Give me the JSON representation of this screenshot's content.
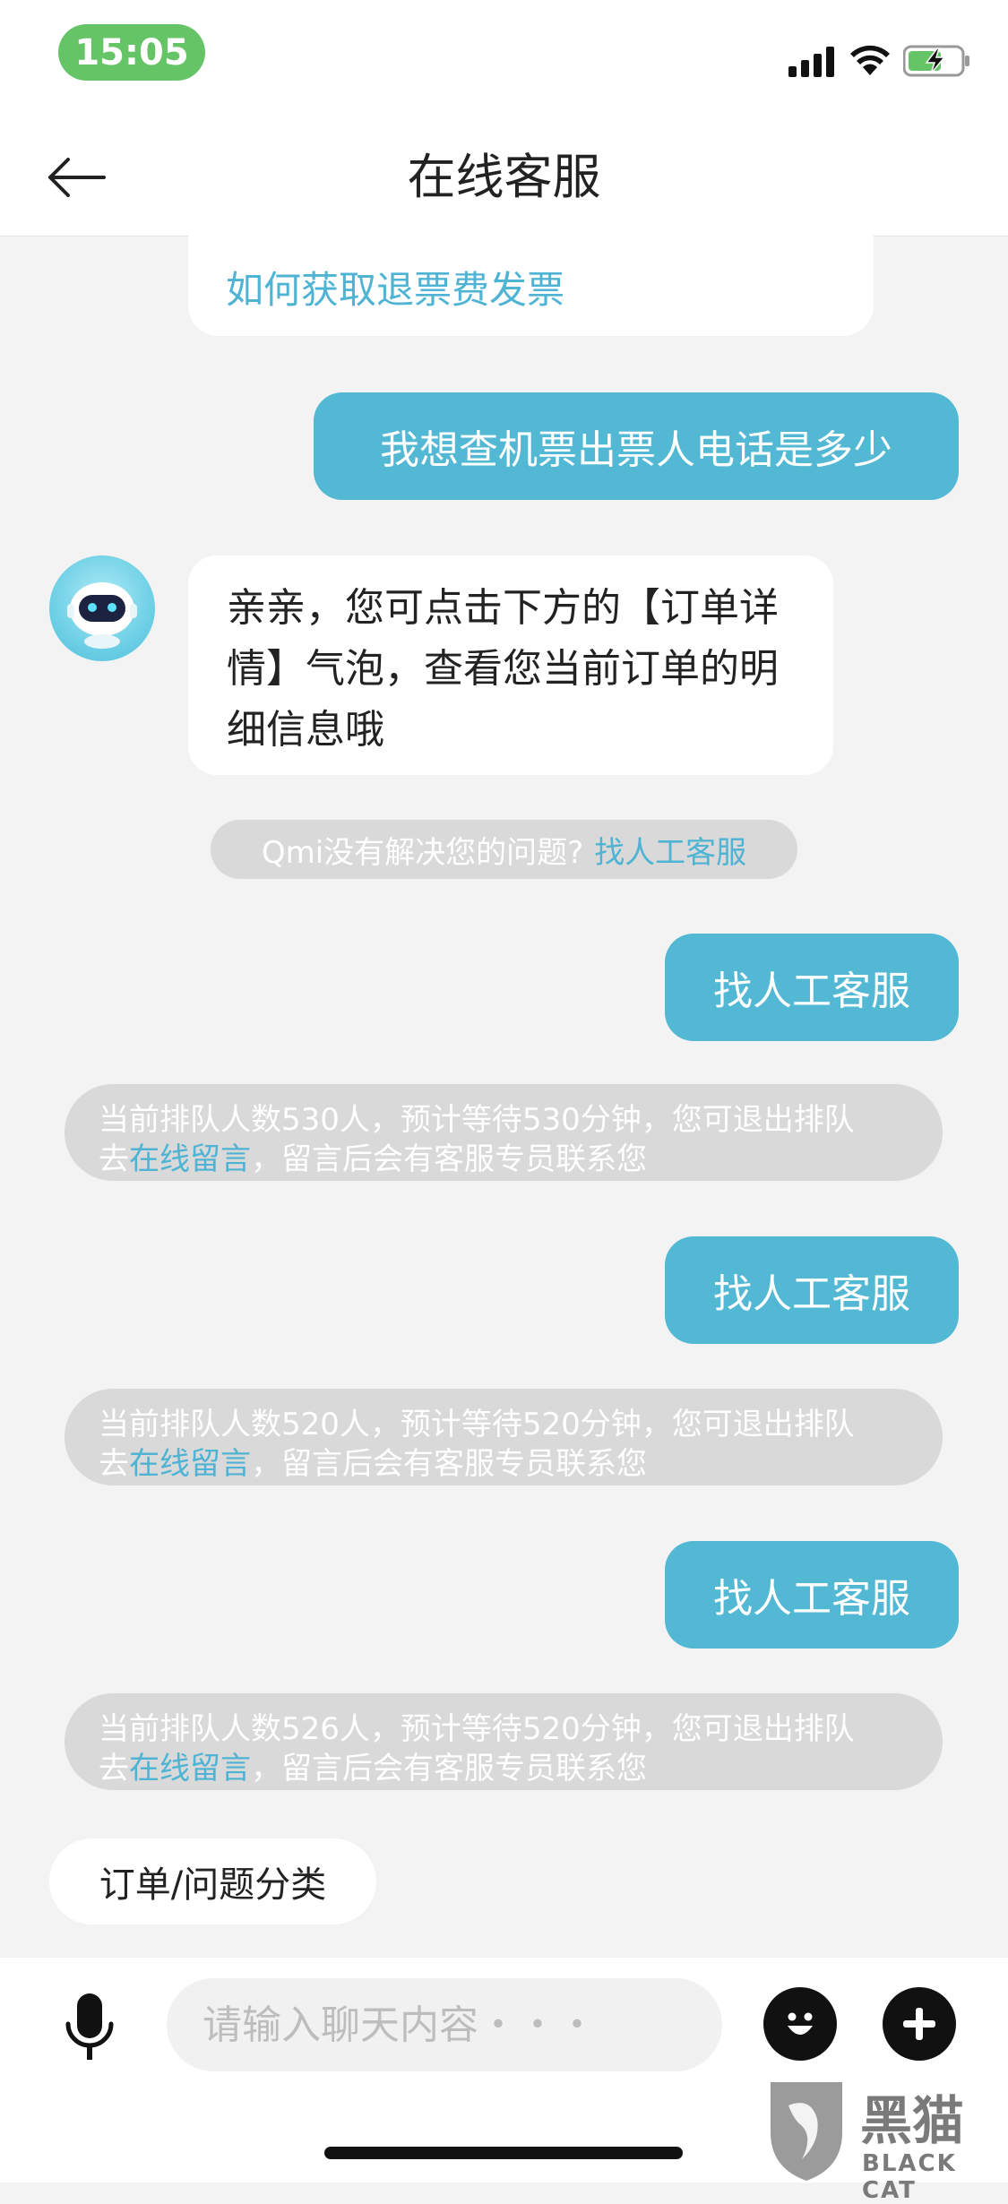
{
  "status_bar": {
    "time": "15:05",
    "icons": [
      "signal-icon",
      "wifi-icon",
      "battery-charging-icon"
    ],
    "time_pill_color": "#65c466"
  },
  "nav": {
    "title": "在线客服",
    "back_icon": "back-arrow-icon"
  },
  "messages": {
    "faq_link": "如何获取退票费发票",
    "user_1": "我想查机票出票人电话是多少",
    "bot_1": "亲亲，您可点击下方的【订单详情】气泡，查看您当前订单的明细信息哦",
    "hint_text": "Qmi没有解决您的问题?",
    "hint_link": "找人工客服",
    "user_2": "找人工客服",
    "queue_1": {
      "line1": "当前排队人数530人，预计等待530分钟，您可退出排队",
      "prefix": "去",
      "link": "在线留言",
      "suffix": "，留言后会有客服专员联系您"
    },
    "user_3": "找人工客服",
    "queue_2": {
      "line1": "当前排队人数520人，预计等待520分钟，您可退出排队",
      "prefix": "去",
      "link": "在线留言",
      "suffix": "，留言后会有客服专员联系您"
    },
    "user_4": "找人工客服",
    "queue_3": {
      "line1": "当前排队人数526人，预计等待520分钟，您可退出排队",
      "prefix": "去",
      "link": "在线留言",
      "suffix": "，留言后会有客服专员联系您"
    }
  },
  "quick_chip": "订单/问题分类",
  "input": {
    "placeholder": "请输入聊天内容・・・",
    "mic_icon": "microphone-icon",
    "emoji_icon": "emoji-icon",
    "plus_icon": "plus-icon"
  },
  "watermark": {
    "cn": "黑猫",
    "en": "BLACK CAT"
  },
  "colors": {
    "user_bubble": "#52b8d3",
    "link": "#4fb3d4",
    "background": "#f3f3f3"
  }
}
